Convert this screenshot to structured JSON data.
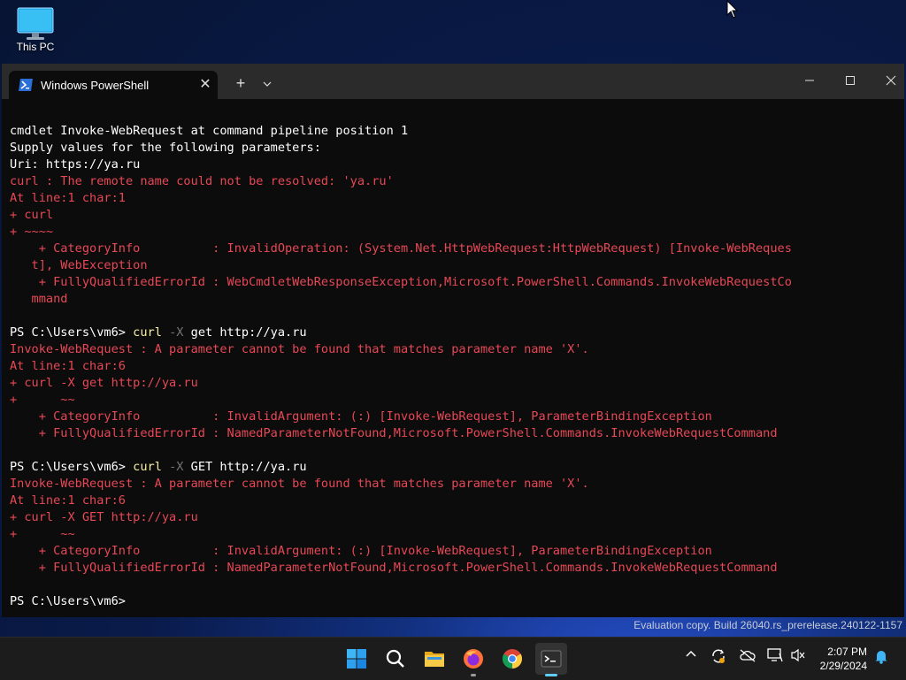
{
  "desktop": {
    "icon_label": "This PC"
  },
  "window": {
    "tab_title": "Windows PowerShell",
    "new_tab_label": "+",
    "close_tab_label": "✕"
  },
  "terminal": {
    "lines": [
      [
        {
          "t": "cmdlet Invoke-WebRequest at command pipeline position 1",
          "c": "w"
        }
      ],
      [
        {
          "t": "Supply values for the following parameters:",
          "c": "w"
        }
      ],
      [
        {
          "t": "Uri: https://ya.ru",
          "c": "w"
        }
      ],
      [
        {
          "t": "curl : The remote name could not be resolved: 'ya.ru'",
          "c": "r"
        }
      ],
      [
        {
          "t": "At line:1 char:1",
          "c": "r"
        }
      ],
      [
        {
          "t": "+ curl",
          "c": "r"
        }
      ],
      [
        {
          "t": "+ ~~~~",
          "c": "r"
        }
      ],
      [
        {
          "t": "    + CategoryInfo          : InvalidOperation: (System.Net.HttpWebRequest:HttpWebRequest) [Invoke-WebReques",
          "c": "r"
        }
      ],
      [
        {
          "t": "   t], WebException",
          "c": "r"
        }
      ],
      [
        {
          "t": "    + FullyQualifiedErrorId : WebCmdletWebResponseException,Microsoft.PowerShell.Commands.InvokeWebRequestCo",
          "c": "r"
        }
      ],
      [
        {
          "t": "   mmand",
          "c": "r"
        }
      ],
      [],
      [
        {
          "t": "PS C:\\Users\\vm6> ",
          "c": "w"
        },
        {
          "t": "curl",
          "c": "y"
        },
        {
          "t": " -X",
          "c": "g"
        },
        {
          "t": " get http://ya.ru",
          "c": "w"
        }
      ],
      [
        {
          "t": "Invoke-WebRequest : A parameter cannot be found that matches parameter name 'X'.",
          "c": "r"
        }
      ],
      [
        {
          "t": "At line:1 char:6",
          "c": "r"
        }
      ],
      [
        {
          "t": "+ curl -X get http://ya.ru",
          "c": "r"
        }
      ],
      [
        {
          "t": "+      ~~",
          "c": "r"
        }
      ],
      [
        {
          "t": "    + CategoryInfo          : InvalidArgument: (:) [Invoke-WebRequest], ParameterBindingException",
          "c": "r"
        }
      ],
      [
        {
          "t": "    + FullyQualifiedErrorId : NamedParameterNotFound,Microsoft.PowerShell.Commands.InvokeWebRequestCommand",
          "c": "r"
        }
      ],
      [],
      [
        {
          "t": "PS C:\\Users\\vm6> ",
          "c": "w"
        },
        {
          "t": "curl",
          "c": "y"
        },
        {
          "t": " -X",
          "c": "g"
        },
        {
          "t": " GET http://ya.ru",
          "c": "w"
        }
      ],
      [
        {
          "t": "Invoke-WebRequest : A parameter cannot be found that matches parameter name 'X'.",
          "c": "r"
        }
      ],
      [
        {
          "t": "At line:1 char:6",
          "c": "r"
        }
      ],
      [
        {
          "t": "+ curl -X GET http://ya.ru",
          "c": "r"
        }
      ],
      [
        {
          "t": "+      ~~",
          "c": "r"
        }
      ],
      [
        {
          "t": "    + CategoryInfo          : InvalidArgument: (:) [Invoke-WebRequest], ParameterBindingException",
          "c": "r"
        }
      ],
      [
        {
          "t": "    + FullyQualifiedErrorId : NamedParameterNotFound,Microsoft.PowerShell.Commands.InvokeWebRequestCommand",
          "c": "r"
        }
      ],
      [],
      [
        {
          "t": "PS C:\\Users\\vm6> ",
          "c": "w"
        }
      ]
    ]
  },
  "watermark": "Evaluation copy. Build 26040.rs_prerelease.240122-1157",
  "taskbar": {
    "apps": [
      {
        "name": "start-button",
        "icon": "windows-logo-icon"
      },
      {
        "name": "search-button",
        "icon": "search-icon"
      },
      {
        "name": "file-explorer-button",
        "icon": "folder-icon"
      },
      {
        "name": "firefox-button",
        "icon": "firefox-icon"
      },
      {
        "name": "chrome-button",
        "icon": "chrome-icon"
      },
      {
        "name": "terminal-button",
        "icon": "terminal-icon"
      }
    ],
    "clock": {
      "time": "2:07 PM",
      "date": "2/29/2024"
    }
  },
  "colors": {
    "error": "#e74856",
    "command": "#f9f1a5",
    "parameter": "#767676",
    "accent": "#60cdff"
  }
}
